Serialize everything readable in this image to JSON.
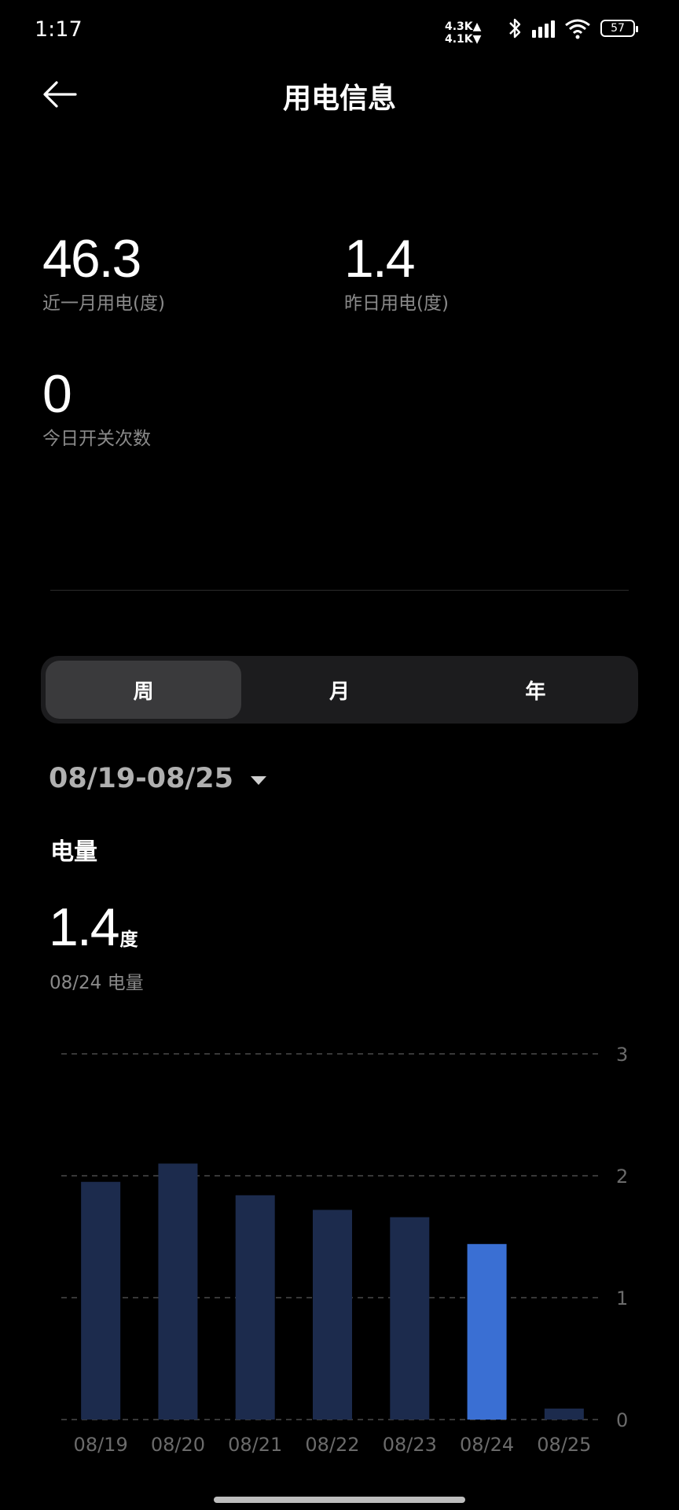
{
  "status_bar": {
    "time": "1:17",
    "net_up": "4.3K▲",
    "net_down": "4.1K▼",
    "battery": "57",
    "icons": [
      "bluetooth-icon",
      "signal-icon",
      "wifi-icon",
      "battery-icon"
    ]
  },
  "header": {
    "title": "用电信息"
  },
  "stats": [
    {
      "value": "46.3",
      "label": "近一月用电(度)"
    },
    {
      "value": "1.4",
      "label": "昨日用电(度)"
    },
    {
      "value": "0",
      "label": "今日开关次数"
    }
  ],
  "tabs": [
    {
      "label": "周",
      "active": true
    },
    {
      "label": "月",
      "active": false
    },
    {
      "label": "年",
      "active": false
    }
  ],
  "date_range": "08/19-08/25",
  "section_title": "电量",
  "selected": {
    "value": "1.4",
    "unit": "度",
    "caption": "08/24 电量"
  },
  "colors": {
    "bar": "#1c2b4d",
    "bar_selected": "#3a6fd3",
    "grid": "#4a4a4a",
    "tick": "#6b6b6b"
  },
  "chart_data": {
    "type": "bar",
    "categories": [
      "08/19",
      "08/20",
      "08/21",
      "08/22",
      "08/23",
      "08/24",
      "08/25"
    ],
    "values": [
      1.95,
      2.1,
      1.84,
      1.72,
      1.66,
      1.44,
      0.09
    ],
    "ylim": [
      0,
      3
    ],
    "yticks": [
      "0",
      "1",
      "2",
      "3"
    ],
    "highlight": "08/24",
    "grid": true
  }
}
